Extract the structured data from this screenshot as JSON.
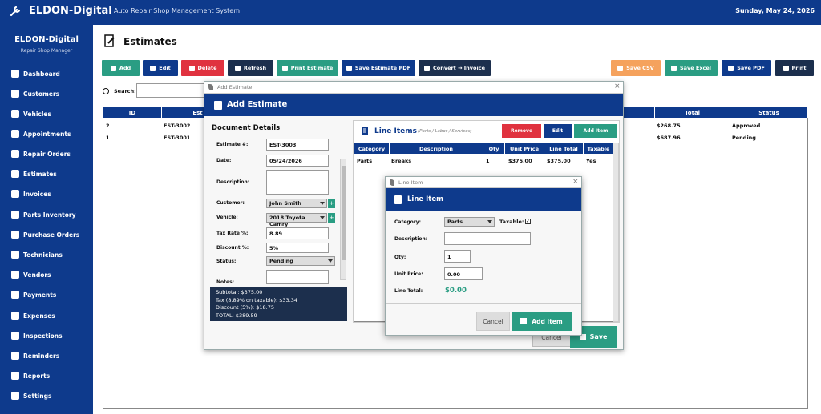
{
  "topbar": {
    "app_name": "ELDON-Digital",
    "subtitle": "Auto Repair Shop Management System",
    "date": "Sunday, May 24, 2026"
  },
  "sidebar": {
    "title": "ELDON-Digital",
    "subtitle": "Repair Shop Manager",
    "items": [
      "Dashboard",
      "Customers",
      "Vehicles",
      "Appointments",
      "Repair Orders",
      "Estimates",
      "Invoices",
      "Parts Inventory",
      "Purchase Orders",
      "Technicians",
      "Vendors",
      "Payments",
      "Expenses",
      "Inspections",
      "Reminders",
      "Reports",
      "Settings"
    ]
  },
  "page": {
    "title": "Estimates"
  },
  "toolbar": {
    "add": "Add",
    "edit": "Edit",
    "delete": "Delete",
    "refresh": "Refresh",
    "print_estimate": "Print Estimate",
    "save_pdf_estimate": "Save Estimate PDF",
    "convert": "Convert → Invoice",
    "save_csv": "Save CSV",
    "save_excel": "Save Excel",
    "save_pdf": "Save PDF",
    "print": "Print",
    "colors": {
      "primary": "#0e3a8c",
      "green": "#2a9d83",
      "red": "#e0323f",
      "orange": "#f5a25d",
      "dark": "#1c2f4d"
    }
  },
  "search": {
    "label": "Search:",
    "value": ""
  },
  "table": {
    "headers": {
      "id": "ID",
      "est": "Est",
      "total": "Total",
      "status": "Status"
    },
    "rows": [
      {
        "id": "2",
        "est": "EST-3002",
        "total": "$268.75",
        "status": "Approved"
      },
      {
        "id": "1",
        "est": "EST-3001",
        "total": "$687.96",
        "status": "Pending"
      }
    ]
  },
  "dialog1": {
    "window_title": "Add Estimate",
    "header": "Add Estimate",
    "section_title": "Document Details",
    "fields": {
      "estimate_label": "Estimate #:",
      "estimate_value": "EST-3003",
      "date_label": "Date:",
      "date_value": "05/24/2026",
      "description_label": "Description:",
      "customer_label": "Customer:",
      "customer_value": "John Smith",
      "vehicle_label": "Vehicle:",
      "vehicle_value": "2018 Toyota Camry",
      "tax_label": "Tax Rate %:",
      "tax_value": "8.89",
      "discount_label": "Discount %:",
      "discount_value": "5%",
      "status_label": "Status:",
      "status_value": "Pending",
      "notes_label": "Notes:"
    },
    "totals": {
      "subtotal": "Subtotal:  $375.00",
      "tax": "Tax (8.89% on taxable):  $33.34",
      "discount": "Discount (5%):  $18.75",
      "total": "TOTAL:  $389.59"
    },
    "line_items": {
      "title": "Line Items",
      "subtitle": "(Parts / Labor / Services)",
      "remove": "Remove",
      "edit": "Edit",
      "add": "Add Item",
      "headers": [
        "Category",
        "Description",
        "Qty",
        "Unit Price",
        "Line Total",
        "Taxable"
      ],
      "rows": [
        [
          "Parts",
          "Breaks",
          "1",
          "$375.00",
          "$375.00",
          "Yes"
        ]
      ]
    },
    "cancel": "Cancel",
    "save": "Save"
  },
  "dialog2": {
    "window_title": "Line Item",
    "header": "Line Item",
    "category_label": "Category:",
    "category_value": "Parts",
    "taxable_label": "Taxable:",
    "taxable_check": "✓",
    "description_label": "Description:",
    "description_value": "",
    "qty_label": "Qty:",
    "qty_value": "1",
    "unit_price_label": "Unit Price:",
    "unit_price_value": "0.00",
    "line_total_label": "Line Total:",
    "line_total_value": "$0.00",
    "cancel": "Cancel",
    "add": "Add Item"
  }
}
